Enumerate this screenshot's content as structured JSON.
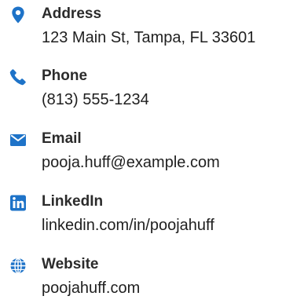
{
  "accent_color": "#1e73c8",
  "contacts": [
    {
      "icon": "map-marker-icon",
      "label": "Address",
      "value": "123 Main St, Tampa, FL 33601"
    },
    {
      "icon": "phone-icon",
      "label": "Phone",
      "value": "(813) 555-1234"
    },
    {
      "icon": "envelope-icon",
      "label": "Email",
      "value": "pooja.huff@example.com"
    },
    {
      "icon": "linkedin-icon",
      "label": "LinkedIn",
      "value": "linkedin.com/in/poojahuff"
    },
    {
      "icon": "globe-icon",
      "label": "Website",
      "value": "poojahuff.com"
    }
  ]
}
